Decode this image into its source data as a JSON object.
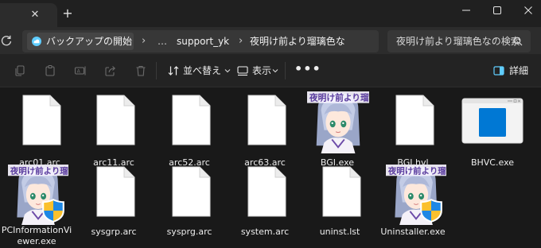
{
  "tabs": {
    "close_glyph": "✕",
    "new_glyph": "+"
  },
  "address": {
    "breadcrumb": [
      "バックアップの開始",
      "…",
      "support_yk",
      "夜明け前より瑠璃色な"
    ],
    "separator": "›"
  },
  "search": {
    "placeholder": "夜明け前より瑠璃色なの検索"
  },
  "toolbar": {
    "sort_label": "並べ替え",
    "view_label": "表示",
    "more_label": "•••",
    "details_label": "詳細"
  },
  "files": [
    {
      "name": "arc01.arc",
      "icon": "document-icon"
    },
    {
      "name": "arc11.arc",
      "icon": "document-icon"
    },
    {
      "name": "arc52.arc",
      "icon": "document-icon"
    },
    {
      "name": "arc63.arc",
      "icon": "document-icon"
    },
    {
      "name": "BGI.exe",
      "icon": "character-app-icon"
    },
    {
      "name": "BGI.hvl",
      "icon": "document-icon"
    },
    {
      "name": "BHVC.exe",
      "icon": "window-app-icon"
    },
    {
      "name": "PCInformationViewer.exe",
      "icon": "character-app-shield-icon"
    },
    {
      "name": "sysgrp.arc",
      "icon": "document-icon"
    },
    {
      "name": "sysprg.arc",
      "icon": "document-icon"
    },
    {
      "name": "system.arc",
      "icon": "document-icon"
    },
    {
      "name": "uninst.lst",
      "icon": "document-icon"
    },
    {
      "name": "Uninstaller.exe",
      "icon": "character-app-shield-icon"
    }
  ],
  "colors": {
    "background": "#191919",
    "chrome": "#202020",
    "address": "#2c2c2c",
    "accent": "#60cdff",
    "folder_blue": "#0078d4"
  }
}
